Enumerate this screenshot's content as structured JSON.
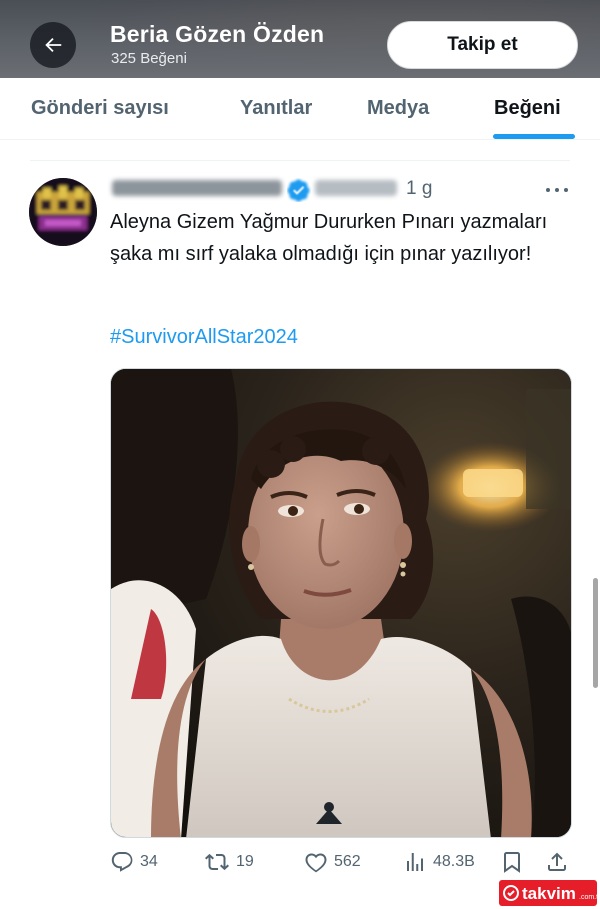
{
  "header": {
    "name": "Beria Gözen Özden",
    "subtitle": "325 Beğeni",
    "follow_label": "Takip et",
    "back_icon": "arrow-left-icon"
  },
  "tabs": [
    {
      "label": "Gönderi sayısı",
      "active": false
    },
    {
      "label": "Yanıtlar",
      "active": false
    },
    {
      "label": "Medya",
      "active": false
    },
    {
      "label": "Beğeni",
      "active": true
    }
  ],
  "post": {
    "time": "1 g",
    "more_icon": "more-horizontal-icon",
    "text": "Aleyna Gizem Yağmur Dururken Pınarı yazmaları şaka mı sırf yalaka olmadığı için pınar yazılıyor!",
    "hashtag": "#SurvivorAllStar2024",
    "media_icon": "photo-icon",
    "stats": {
      "replies": "34",
      "reposts": "19",
      "likes": "562",
      "views": "48.3B"
    }
  },
  "watermark": {
    "text": "takvim",
    "suffix": ".com.tr"
  },
  "colors": {
    "accent": "#1d9bf0",
    "text_primary": "#0f1419",
    "text_secondary": "#536471",
    "watermark_red": "#e30613"
  }
}
